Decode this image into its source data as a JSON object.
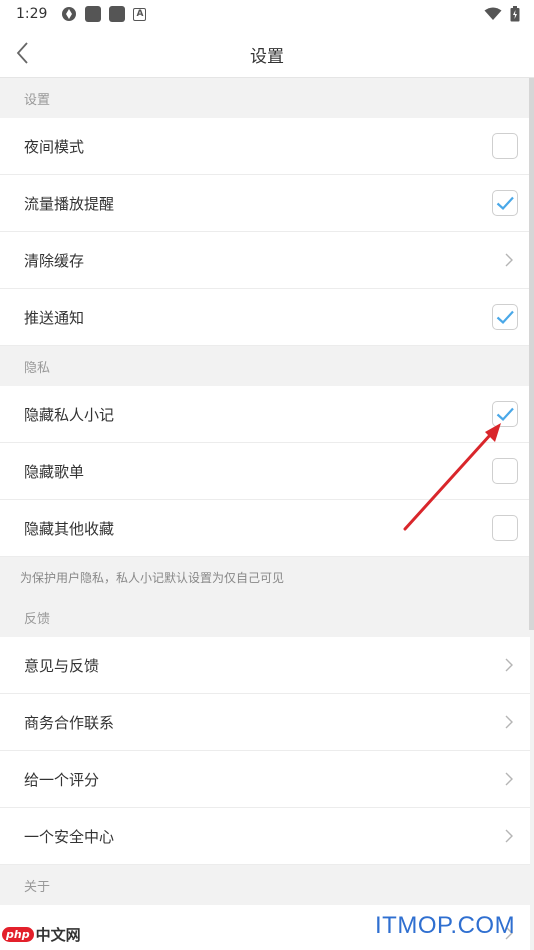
{
  "status_bar": {
    "time": "1:29"
  },
  "header": {
    "title": "设置"
  },
  "sections": [
    {
      "title": "设置",
      "items": [
        {
          "label": "夜间模式",
          "control": "checkbox",
          "checked": false
        },
        {
          "label": "流量播放提醒",
          "control": "checkbox",
          "checked": true
        },
        {
          "label": "清除缓存",
          "control": "chevron"
        },
        {
          "label": "推送通知",
          "control": "checkbox",
          "checked": true
        }
      ]
    },
    {
      "title": "隐私",
      "items": [
        {
          "label": "隐藏私人小记",
          "control": "checkbox",
          "checked": true
        },
        {
          "label": "隐藏歌单",
          "control": "checkbox",
          "checked": false
        },
        {
          "label": "隐藏其他收藏",
          "control": "checkbox",
          "checked": false
        }
      ],
      "note": "为保护用户隐私，私人小记默认设置为仅自己可见"
    },
    {
      "title": "反馈",
      "items": [
        {
          "label": "意见与反馈",
          "control": "chevron"
        },
        {
          "label": "商务合作联系",
          "control": "chevron"
        },
        {
          "label": "给一个评分",
          "control": "chevron"
        },
        {
          "label": "一个安全中心",
          "control": "chevron"
        }
      ]
    },
    {
      "title": "关于",
      "items": []
    }
  ],
  "watermarks": {
    "left_badge": "php",
    "left_text": "中文网",
    "right": "ITMOP.COM"
  },
  "colors": {
    "check_accent": "#4aa8e8",
    "annotation_arrow": "#d9262b"
  }
}
